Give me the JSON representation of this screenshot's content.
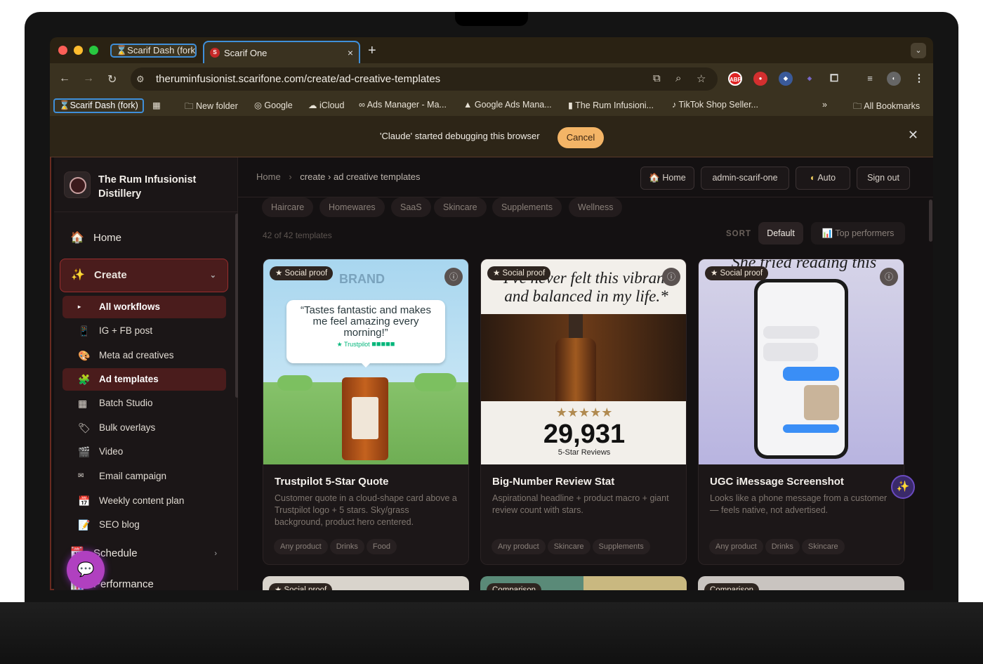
{
  "browser": {
    "tab_inactive": "⌛Scarif Dash (fork)",
    "tab_active": "Scarif One",
    "tab_active_favicon": "S",
    "tab_close": "×",
    "new_tab": "+",
    "tab_menu": "⌄",
    "url": "theruminfusionist.scarifone.com/create/ad-creative-templates",
    "bookmarks": [
      "⌛Scarif Dash (fork)",
      "New folder",
      "Google",
      "iCloud",
      "Ads Manager - Ma...",
      "Google Ads Mana...",
      "The Rum Infusioni...",
      "TikTok Shop Seller..."
    ],
    "bookmarks_more": "»",
    "all_bookmarks": "All Bookmarks",
    "debug_message": "'Claude' started debugging this browser",
    "debug_cancel": "Cancel",
    "debug_close": "✕",
    "ext_abp": "ABP"
  },
  "sidebar": {
    "brand_name": "The Rum Infusionist Distillery",
    "home": "Home",
    "create": "Create",
    "sub_items": [
      "All workflows",
      "IG + FB post",
      "Meta ad creatives",
      "Ad templates",
      "Batch Studio",
      "Bulk overlays",
      "Video",
      "Email campaign",
      "Weekly content plan",
      "SEO blog"
    ],
    "schedule": "Schedule",
    "performance": "Performance"
  },
  "header": {
    "crumb_home": "Home",
    "crumb_sep": "›",
    "crumb_rest": "create › ad creative templates",
    "home_btn": "🏠 Home",
    "account": "admin-scarif-one",
    "theme": "Auto",
    "signout": "Sign out"
  },
  "filters": [
    "Haircare",
    "Homewares",
    "SaaS",
    "Skincare",
    "Supplements",
    "Wellness"
  ],
  "count_text": "42 of 42 templates",
  "sort": {
    "label": "SORT",
    "default": "Default",
    "top": "📊 Top performers"
  },
  "cards": [
    {
      "badge": "★ Social proof",
      "title": "Trustpilot 5-Star Quote",
      "desc": "Customer quote in a cloud-shape card above a Trustpilot logo + 5 stars. Sky/grass background, product hero centered.",
      "tags": [
        "Any product",
        "Drinks",
        "Food"
      ],
      "art_brand": "BRAND",
      "art_quote": "“Tastes fantastic and makes me feel amazing every morning!”",
      "art_trust": "★ Trustpilot"
    },
    {
      "badge": "★ Social proof",
      "title": "Big-Number Review Stat",
      "desc": "Aspirational headline + product macro + giant review count with stars.",
      "tags": [
        "Any product",
        "Skincare",
        "Supplements"
      ],
      "art_headline": "I've never felt this vibrant and balanced in my life.*",
      "art_stars": "★★★★★",
      "art_number": "29,931",
      "art_sub": "5-Star Reviews"
    },
    {
      "badge": "★ Social proof",
      "title": "UGC iMessage Screenshot",
      "desc": "Looks like a phone message from a customer — feels native, not advertised.",
      "tags": [
        "Any product",
        "Drinks",
        "Skincare"
      ],
      "art_head": "She tried reading this"
    }
  ],
  "row2_badges": [
    "★ Social proof",
    "Comparison",
    "Comparison"
  ],
  "colors": {
    "accent": "#f3b466",
    "active": "#4a1c1c",
    "border": "#9a2e2e"
  }
}
